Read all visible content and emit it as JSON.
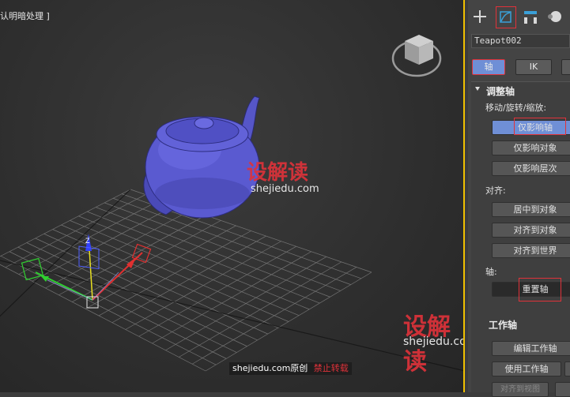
{
  "viewport": {
    "label": "[默认明暗处理 ]",
    "label_display": "认明暗处理 ]",
    "gizmo_axis_z": "Z"
  },
  "panel": {
    "object_name": "Teapot002",
    "tabs": {
      "axis": "轴",
      "ik": "IK"
    },
    "adjust_pivot": {
      "title": "调整轴",
      "move_rotate_scale_label": "移动/旋转/缩放:",
      "affect_pivot_only": "仅影响轴",
      "affect_object_only": "仅影响对象",
      "affect_hierarchy_only": "仅影响层次",
      "alignment_label": "对齐:",
      "center_to_object": "居中到对象",
      "align_to_object": "对齐到对象",
      "align_to_world": "对齐到世界",
      "pivot_label": "轴:",
      "reset_pivot": "重置轴"
    },
    "working_pivot": {
      "title": "工作轴",
      "edit_working_pivot": "编辑工作轴",
      "use_working_pivot": "使用工作轴",
      "align_to_view": "对齐到视图"
    }
  },
  "watermark": {
    "logo": "设解读",
    "url": "shejiedu.com",
    "credit_prefix": "shejiedu.com原创",
    "credit_suffix": "禁止转载"
  },
  "colors": {
    "teapot": "#5a5ad0",
    "highlight": "#e0323a",
    "active_tab": "#6f8fd6",
    "viewport_border": "#f0c000"
  }
}
